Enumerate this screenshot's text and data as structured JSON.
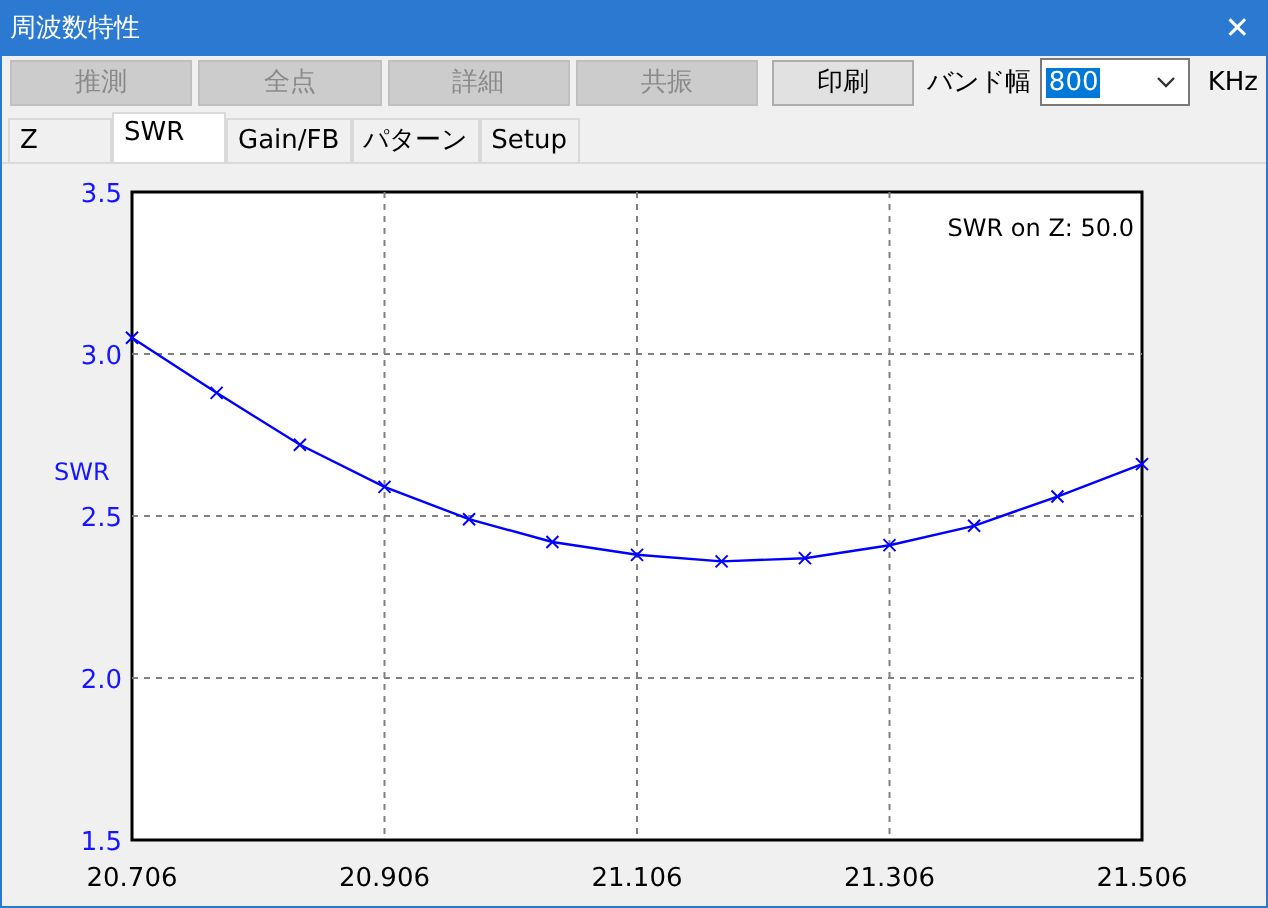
{
  "window": {
    "title": "周波数特性",
    "close": "✕"
  },
  "toolbar": {
    "buttons": [
      {
        "label": "推測",
        "disabled": true
      },
      {
        "label": "全点",
        "disabled": true
      },
      {
        "label": "詳細",
        "disabled": true
      },
      {
        "label": "共振",
        "disabled": true
      },
      {
        "label": "印刷",
        "disabled": false
      }
    ],
    "bandwidth": {
      "label": "バンド幅",
      "value": "800",
      "unit": "KHz"
    }
  },
  "tabs": [
    {
      "label": "Z",
      "selected": false
    },
    {
      "label": "SWR",
      "selected": true
    },
    {
      "label": "Gain/FB",
      "selected": false
    },
    {
      "label": "パターン",
      "selected": false
    },
    {
      "label": "Setup",
      "selected": false
    }
  ],
  "chart": {
    "legend": "SWR on Z: 50.0",
    "chart_data": {
      "type": "line",
      "grid": true,
      "ylabel": "SWR",
      "xlim": [
        20.706,
        21.506
      ],
      "ylim": [
        1.5,
        3.5
      ],
      "xticks": [
        {
          "value": 20.706,
          "label": "20.706"
        },
        {
          "value": 20.906,
          "label": "20.906"
        },
        {
          "value": 21.106,
          "label": "21.106"
        },
        {
          "value": 21.306,
          "label": "21.306"
        },
        {
          "value": 21.506,
          "label": "21.506"
        }
      ],
      "yticks": [
        {
          "value": 1.5,
          "label": "1.5"
        },
        {
          "value": 2.0,
          "label": "2.0"
        },
        {
          "value": 2.5,
          "label": "2.5"
        },
        {
          "value": 3.0,
          "label": "3.0"
        },
        {
          "value": 3.5,
          "label": "3.5"
        }
      ],
      "x": [
        20.706,
        20.773,
        20.839,
        20.906,
        20.973,
        21.039,
        21.106,
        21.173,
        21.239,
        21.306,
        21.373,
        21.439,
        21.506
      ],
      "series": [
        {
          "color": "#0000ff",
          "marker": "x",
          "values": [
            3.05,
            2.88,
            2.72,
            2.59,
            2.49,
            2.42,
            2.38,
            2.36,
            2.37,
            2.41,
            2.47,
            2.56,
            2.66
          ]
        }
      ]
    }
  }
}
